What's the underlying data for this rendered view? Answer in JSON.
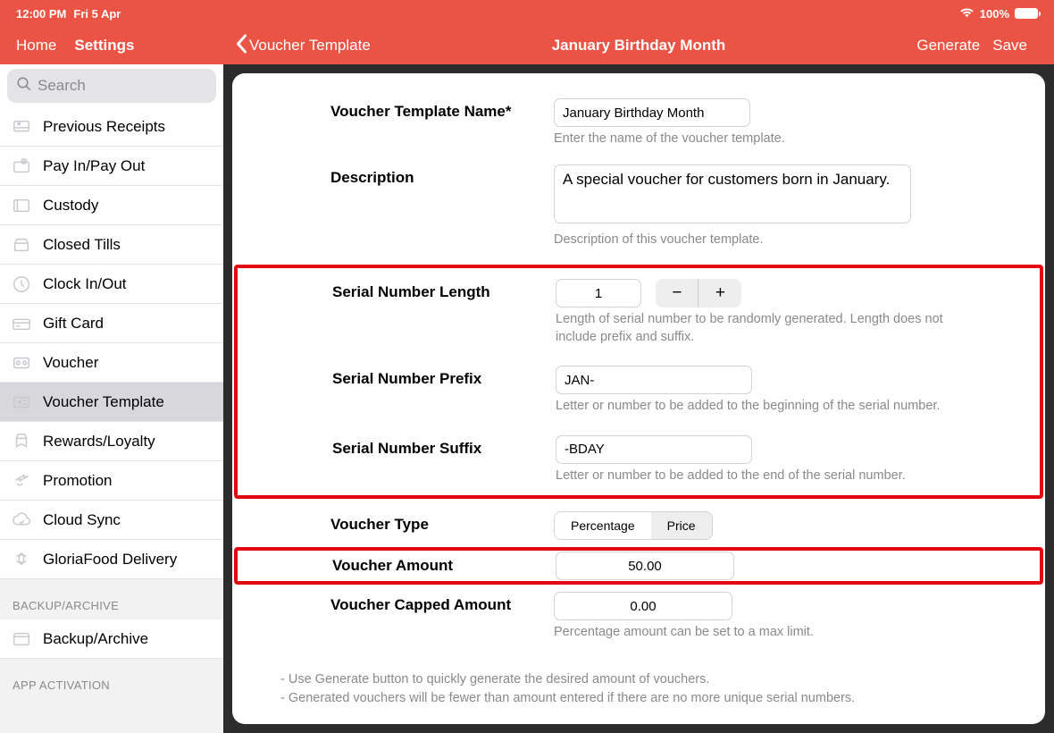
{
  "status": {
    "time": "12:00 PM",
    "date": "Fri 5 Apr",
    "battery": "100%"
  },
  "nav": {
    "home": "Home",
    "settings": "Settings",
    "back": "Voucher Template",
    "title": "January Birthday Month",
    "generate": "Generate",
    "save": "Save"
  },
  "search": {
    "placeholder": "Search"
  },
  "menu": {
    "items": [
      {
        "label": "Previous Receipts"
      },
      {
        "label": "Pay In/Pay Out"
      },
      {
        "label": "Custody"
      },
      {
        "label": "Closed Tills"
      },
      {
        "label": "Clock In/Out"
      },
      {
        "label": "Gift Card"
      },
      {
        "label": "Voucher"
      },
      {
        "label": "Voucher Template",
        "selected": true
      },
      {
        "label": "Rewards/Loyalty"
      },
      {
        "label": "Promotion"
      },
      {
        "label": "Cloud Sync"
      },
      {
        "label": "GloriaFood Delivery"
      }
    ],
    "section1": "BACKUP/ARCHIVE",
    "backup": "Backup/Archive",
    "section2": "APP ACTIVATION"
  },
  "form": {
    "name_label": "Voucher Template Name*",
    "name_value": "January Birthday Month",
    "name_hint": "Enter the name of the voucher template.",
    "desc_label": "Description",
    "desc_value": "A special voucher for customers born in January.",
    "desc_hint": "Description of this voucher template.",
    "len_label": "Serial Number Length",
    "len_value": "1",
    "len_hint": "Length of serial number to be randomly generated. Length does not include prefix and suffix.",
    "prefix_label": "Serial Number Prefix",
    "prefix_value": "JAN-",
    "prefix_hint": "Letter or number to be added to the beginning of the serial number.",
    "suffix_label": "Serial Number Suffix",
    "suffix_value": "-BDAY",
    "suffix_hint": "Letter or number to be added to the end of the serial number.",
    "type_label": "Voucher Type",
    "type_opt1": "Percentage",
    "type_opt2": "Price",
    "amount_label": "Voucher Amount",
    "amount_value": "50.00",
    "capped_label": "Voucher Capped Amount",
    "capped_value": "0.00",
    "capped_hint": "Percentage amount can be set to a max limit.",
    "note1": "- Use Generate button to quickly generate the desired amount of vouchers.",
    "note2": "- Generated vouchers will be fewer than amount entered if there are no more unique serial numbers."
  }
}
